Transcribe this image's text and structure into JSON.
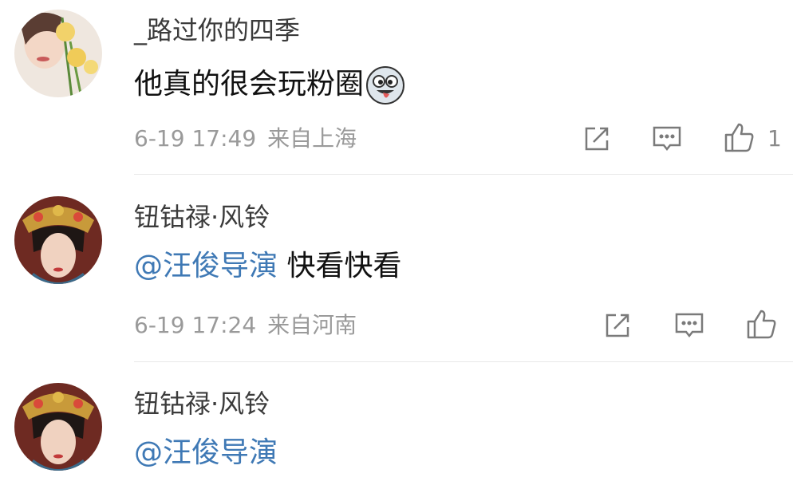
{
  "comments": [
    {
      "username": "_路过你的四季",
      "text": "他真的很会玩粉圈",
      "emoji": "laughing-tongue-emoji",
      "time": "6-19 17:49",
      "location": "来自上海",
      "likes": "1"
    },
    {
      "username": "钮钴禄·风铃",
      "mention": "@汪俊导演",
      "text": "快看快看",
      "time": "6-19 17:24",
      "location": "来自河南"
    },
    {
      "username": "钮钴禄·风铃",
      "mention": "@汪俊导演",
      "text": ""
    }
  ],
  "icons": {
    "share": "share-icon",
    "comment": "comment-icon",
    "like": "thumbs-up-icon"
  },
  "colors": {
    "mention": "#3f79b5",
    "meta": "#9a9a9a",
    "divider": "#e8e8e8"
  }
}
